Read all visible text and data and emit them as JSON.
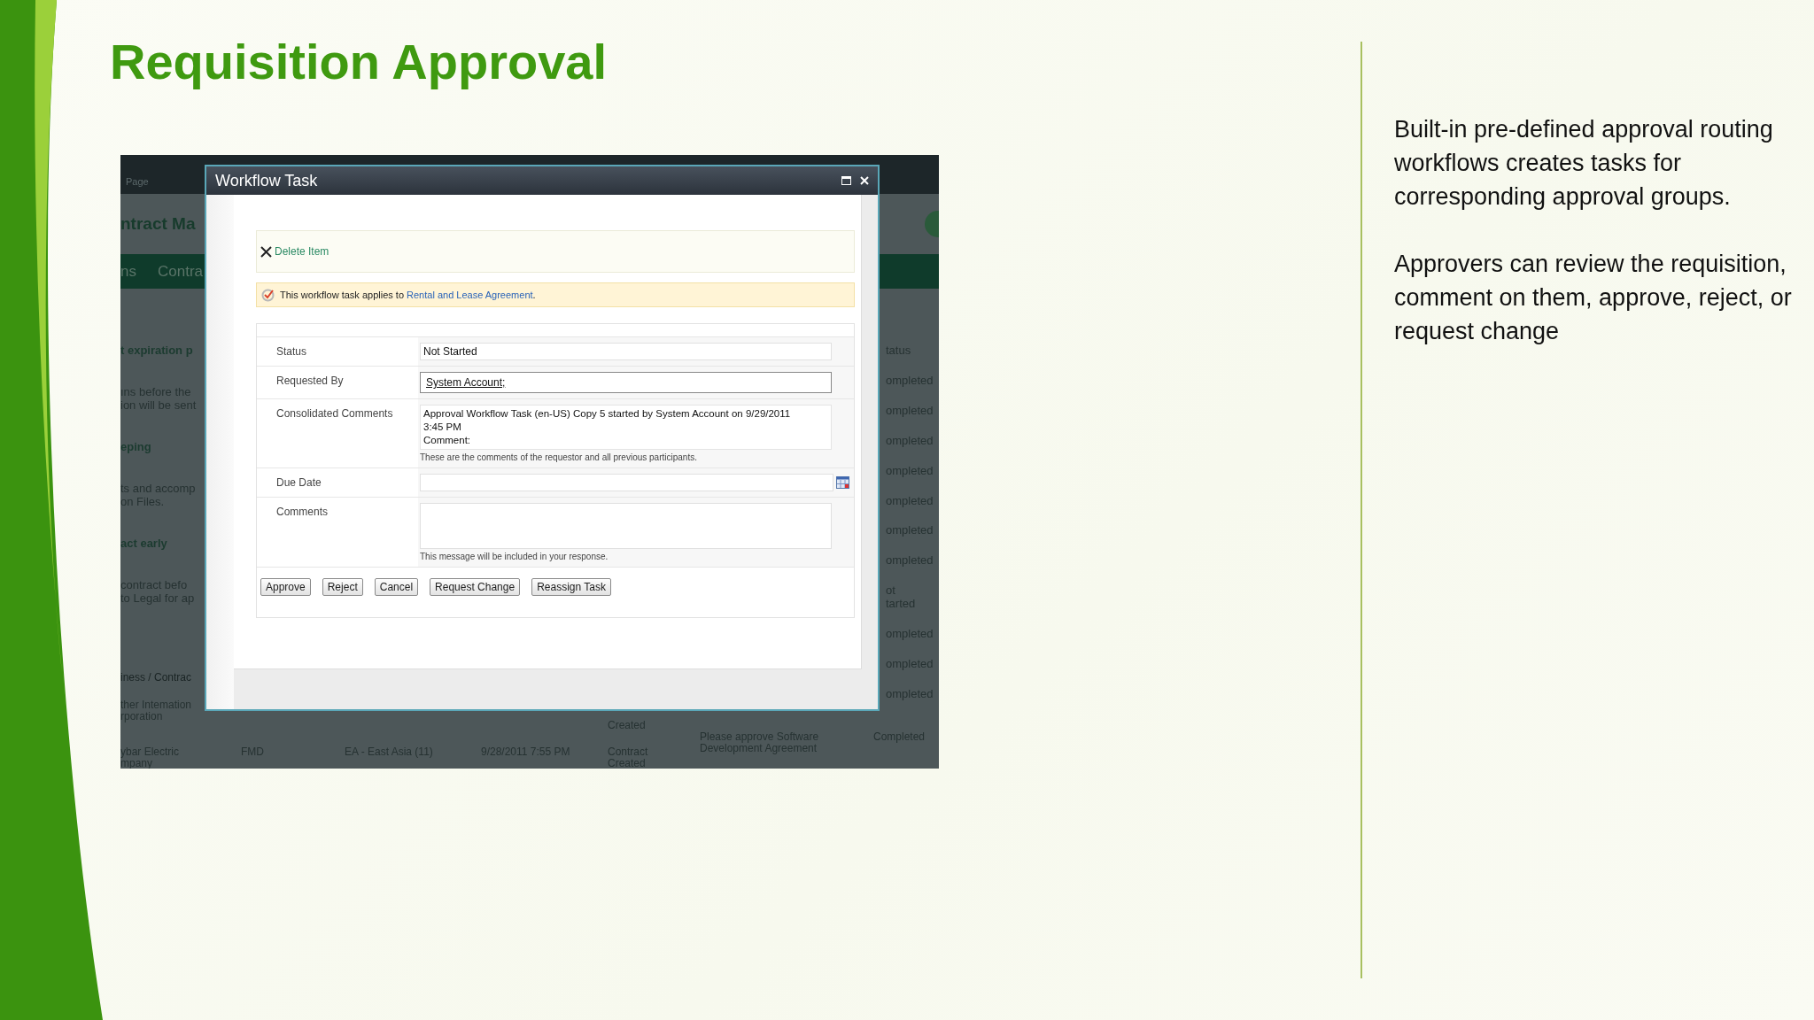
{
  "slide": {
    "title": "Requisition Approval",
    "paragraphs": [
      "Built-in pre-defined approval routing workflows creates tasks for corresponding approval groups.",
      "Approvers can review the requisition, comment on them, approve, reject, or request change"
    ]
  },
  "screenshot": {
    "background": {
      "top_bar": "Page",
      "header": "ntract Ma",
      "nav": [
        "ns",
        "Contra"
      ],
      "left_column": [
        {
          "lines": [
            "t expiration p"
          ],
          "bold": true
        },
        {
          "lines": [
            "ıns before the",
            "ion will be sent"
          ],
          "bold": false
        },
        {
          "lines": [
            "eping"
          ],
          "bold": true
        },
        {
          "lines": [
            "ts and accomp",
            "on Files."
          ],
          "bold": false
        },
        {
          "lines": [
            "act early"
          ],
          "bold": true
        },
        {
          "lines": [
            "contract befo",
            "to Legal for ap"
          ],
          "bold": false
        }
      ],
      "breadcrumb": "iness / Contrac",
      "status_column": [
        [
          "tatus"
        ],
        [
          "ompleted"
        ],
        [
          "ompleted"
        ],
        [
          "ompleted"
        ],
        [
          "ompleted"
        ],
        [
          "ompleted"
        ],
        [
          "ompleted"
        ],
        [
          "ompleted"
        ],
        [
          "ot",
          "tarted"
        ],
        [
          "ompleted"
        ],
        [
          "ompleted"
        ],
        [
          "ompleted"
        ]
      ],
      "rows": [
        {
          "column_1": [
            "ther Intemation",
            "rporation"
          ],
          "column_5": [
            "Created"
          ]
        },
        {
          "column_1": [
            "ybar Electric",
            "mpany"
          ],
          "column_2": [
            "FMD"
          ],
          "column_3": [
            "EA - East Asia (11)"
          ],
          "column_4": [
            "9/28/2011 7:55 PM"
          ],
          "column_5": [
            "Contract",
            "Created"
          ],
          "column_6": [
            "Please approve Software",
            "Development Agreement"
          ],
          "column_7": [
            "Completed"
          ]
        }
      ]
    },
    "dialog": {
      "title": "Workflow Task",
      "toolbar_action": "Delete Item",
      "notice": {
        "text": "This workflow task applies to",
        "link": "Rental and Lease Agreement",
        "end": "."
      },
      "fields": [
        {
          "kind": "text",
          "label": "Status",
          "value": "Not Started"
        },
        {
          "kind": "people",
          "label": "Requested By",
          "value": "System Account;"
        },
        {
          "kind": "readonly",
          "label": "Consolidated Comments",
          "lines": [
            "Approval Workflow Task (en-US) Copy 5 started by System Account on 9/29/2011",
            "3:45 PM",
            "Comment:"
          ],
          "hint": "These are the comments of the requestor and all previous participants."
        },
        {
          "kind": "date",
          "label": "Due Date"
        },
        {
          "kind": "textarea",
          "label": "Comments",
          "hint": "This message will be included in your response."
        }
      ],
      "buttons": [
        "Approve",
        "Reject",
        "Cancel",
        "Request Change",
        "Reassign Task"
      ]
    }
  }
}
